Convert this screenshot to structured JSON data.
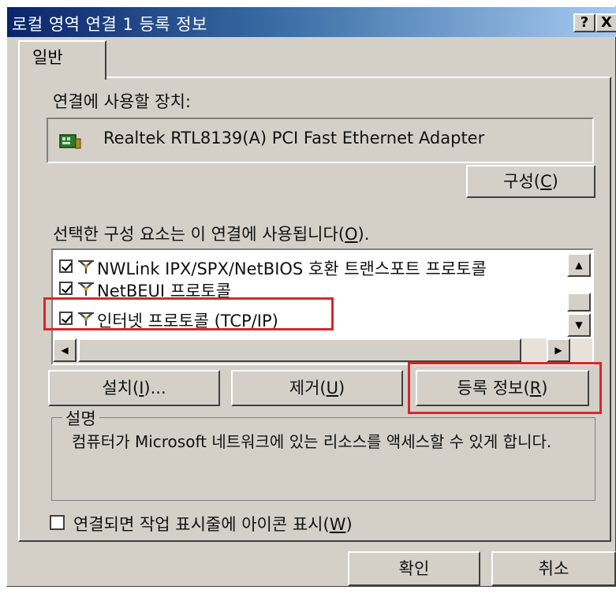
{
  "window": {
    "title": "로컬 영역 연결 1 등록 정보",
    "help_label": "?",
    "close_label": "X"
  },
  "tabs": [
    {
      "label": "일반"
    }
  ],
  "general": {
    "device_label": "연결에 사용할 장치:",
    "device_name": "Realtek RTL8139(A) PCI Fast Ethernet Adapter",
    "configure_button": {
      "label": "구성(",
      "hotkey": "C",
      "suffix": ")"
    },
    "components_label": {
      "label": "선택한 구성 요소는 이 연결에 사용됩니다(",
      "hotkey": "O",
      "suffix": ")."
    },
    "components": [
      {
        "label": "NWLink IPX/SPX/NetBIOS 호환 트랜스포트 프로토콜",
        "checked": true,
        "icon": "network-protocol-icon"
      },
      {
        "label": "NetBEUI 프로토콜",
        "checked": true,
        "icon": "network-protocol-icon"
      },
      {
        "label": "인터넷 프로토콜 (TCP/IP)",
        "checked": true,
        "icon": "network-protocol-icon",
        "highlighted": true
      }
    ],
    "install_button": {
      "label": "설치(",
      "hotkey": "I",
      "suffix": ")..."
    },
    "uninstall_button": {
      "label": "제거(",
      "hotkey": "U",
      "suffix": ")"
    },
    "properties_button": {
      "label": "등록 정보(",
      "hotkey": "R",
      "suffix": ")",
      "highlighted": true
    },
    "description_title": "설명",
    "description_text": "컴퓨터가 Microsoft 네트워크에 있는 리소스를 액세스할 수 있게 합니다.",
    "show_icon_checkbox": {
      "label": "연결되면 작업 표시줄에 아이콘 표시(",
      "hotkey": "W",
      "suffix": ")",
      "checked": false
    }
  },
  "footer": {
    "ok_label": "확인",
    "cancel_label": "취소"
  },
  "colors": {
    "highlight_box": "#d9262c",
    "title_gradient_start": "#0a246a",
    "dialog_face": "#d4d0c8"
  }
}
